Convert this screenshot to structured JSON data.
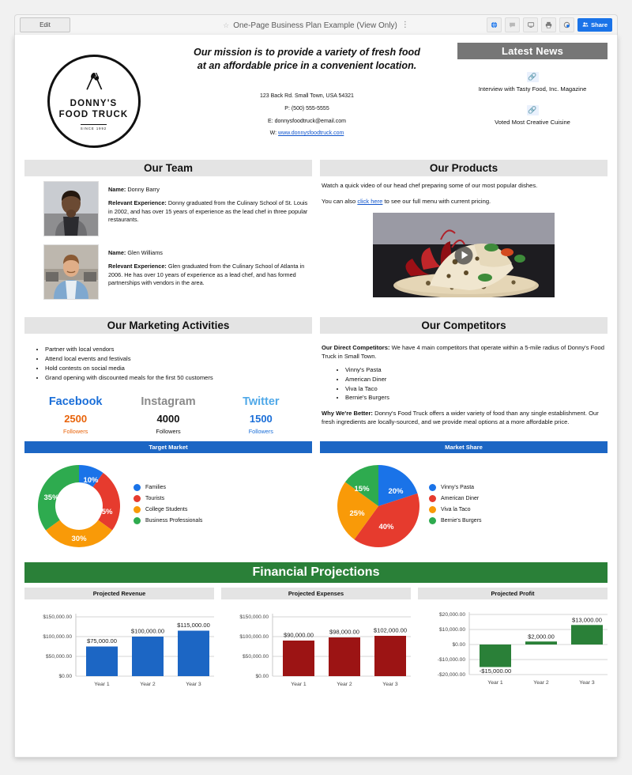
{
  "toolbar": {
    "edit_label": "Edit",
    "doc_title": "One-Page Business Plan Example (View Only)",
    "star_icon": "star-outline-icon",
    "kebab_icon": "more-vertical-icon",
    "icons": [
      {
        "name": "globe-icon",
        "glyph": "⊕"
      },
      {
        "name": "comment-icon",
        "glyph": "✎"
      },
      {
        "name": "present-icon",
        "glyph": "▭"
      },
      {
        "name": "print-icon",
        "glyph": "⎙"
      },
      {
        "name": "history-icon",
        "glyph": "⟳"
      }
    ],
    "share_label": "Share",
    "share_icon": "people-icon",
    "accent_blue": "#1a73e8"
  },
  "header": {
    "logo": {
      "name_line1": "DONNY'S",
      "name_line2": "FOOD TRUCK",
      "since": "SINCE 1992",
      "icon": "crossed-utensils-icon"
    },
    "mission": "Our mission is to provide a variety of fresh food at an affordable price in a convenient location.",
    "contact": {
      "address": "123 Back Rd. Small Town, USA 54321",
      "phone": "P: (500) 555-5555",
      "email": "E: donnysfoodtruck@email.com",
      "website_prefix": "W: ",
      "website": "www.donnysfoodtruck.com"
    },
    "news": {
      "title": "Latest News",
      "header_color": "#767676",
      "items": [
        {
          "icon": "link-icon",
          "label": "Interview with Tasty Food, Inc. Magazine"
        },
        {
          "icon": "link-icon",
          "label": "Voted Most Creative Cuisine"
        }
      ]
    }
  },
  "team": {
    "title": "Our Team",
    "name_label": "Name:",
    "exp_label": "Relevant Experience:",
    "members": [
      {
        "photo": "portrait-donny-barry",
        "name": "Donny Barry",
        "experience": "Donny graduated from the Culinary School of St. Louis in 2002, and has over 15 years of experience as the lead chef in three popular restaurants."
      },
      {
        "photo": "portrait-glen-williams",
        "name": "Glen Williams",
        "experience": "Glen graduated from the Culinary School of Atlanta in 2006. He has over 10 years of experience as a lead chef, and has formed partnerships with vendors in the area."
      }
    ]
  },
  "products": {
    "title": "Our Products",
    "line1": "Watch a quick video of our head chef preparing some of our most popular dishes.",
    "line2_before": "You can also ",
    "line2_link": "click here",
    "line2_after": " to see our full menu with current pricing.",
    "video": {
      "name": "chef-dish-video-thumbnail",
      "play_icon": "play-icon"
    }
  },
  "marketing": {
    "title": "Our Marketing Activities",
    "activities": [
      "Partner with local vendors",
      "Attend local events and festivals",
      "Hold contests on social media",
      "Grand opening with discounted meals for the first 50 customers"
    ],
    "socials": [
      {
        "network": "Facebook",
        "count": "2500",
        "label": "Followers",
        "name_color": "#1a6ed8",
        "count_color": "#e8630a"
      },
      {
        "network": "Instagram",
        "count": "4000",
        "label": "Followers",
        "name_color": "#8a8a8a",
        "count_color": "#111111"
      },
      {
        "network": "Twitter",
        "count": "1500",
        "label": "Followers",
        "name_color": "#4fa8e8",
        "count_color": "#1a6ed8"
      }
    ]
  },
  "competitors": {
    "title": "Our Competitors",
    "direct_label": "Our Direct Competitors:",
    "direct_text": " We have 4 main competitors that operate within a 5-mile radius of Donny's Food Truck in Small Town.",
    "list": [
      "Vinny's Pasta",
      "American Diner",
      "Viva la Taco",
      "Bernie's Burgers"
    ],
    "better_label": "Why We're Better:",
    "better_text": " Donny's Food Truck offers a wider variety of food than any single establishment. Our fresh ingredients are locally-sourced, and we provide meal options at a more affordable price."
  },
  "financial": {
    "title": "Financial Projections",
    "banner_color": "#2a8038"
  },
  "chart_data": [
    {
      "type": "pie",
      "variant": "donut",
      "title": "Target Market",
      "title_bg": "#1c66c4",
      "labels": [
        "Families",
        "Tourists",
        "College Students",
        "Business Professionals"
      ],
      "values": [
        10,
        25,
        30,
        35
      ],
      "data_labels": [
        "10%",
        "25%",
        "30%",
        "35%"
      ],
      "colors": [
        "#1a73e8",
        "#e63b2e",
        "#f99a08",
        "#2eab4f"
      ],
      "legend": "right"
    },
    {
      "type": "pie",
      "title": "Market Share",
      "title_bg": "#1c66c4",
      "labels": [
        "Vinny's Pasta",
        "American Diner",
        "Viva la Taco",
        "Bernie's Burgers"
      ],
      "values": [
        20,
        40,
        25,
        15
      ],
      "data_labels": [
        "20%",
        "40%",
        "25%",
        "15%"
      ],
      "colors": [
        "#1a73e8",
        "#e63b2e",
        "#f99a08",
        "#2eab4f"
      ],
      "legend": "right"
    },
    {
      "type": "bar",
      "title": "Projected Revenue",
      "categories": [
        "Year 1",
        "Year 2",
        "Year 3"
      ],
      "values": [
        75000,
        100000,
        115000
      ],
      "data_labels": [
        "$75,000.00",
        "$100,000.00",
        "$115,000.00"
      ],
      "ytick_labels": [
        "$150,000.00",
        "$100,000.00",
        "$50,000.00",
        "$0.00"
      ],
      "ylim": [
        0,
        150000
      ],
      "color": "#1c66c4",
      "grid": true
    },
    {
      "type": "bar",
      "title": "Projected Expenses",
      "categories": [
        "Year 1",
        "Year 2",
        "Year 3"
      ],
      "values": [
        90000,
        98000,
        102000
      ],
      "data_labels": [
        "$90,000.00",
        "$98,000.00",
        "$102,000.00"
      ],
      "ytick_labels": [
        "$150,000.00",
        "$100,000.00",
        "$50,000.00",
        "$0.00"
      ],
      "ylim": [
        0,
        150000
      ],
      "color": "#9c1414",
      "grid": true
    },
    {
      "type": "bar",
      "title": "Projected Profit",
      "categories": [
        "Year 1",
        "Year 2",
        "Year 3"
      ],
      "values": [
        -15000,
        2000,
        13000
      ],
      "data_labels": [
        "-$15,000.00",
        "$2,000.00",
        "$13,000.00"
      ],
      "ytick_labels": [
        "$20,000.00",
        "$10,000.00",
        "$0.00",
        "-$10,000.00",
        "-$20,000.00"
      ],
      "ylim": [
        -20000,
        20000
      ],
      "color": "#2a8038",
      "grid": true
    }
  ]
}
